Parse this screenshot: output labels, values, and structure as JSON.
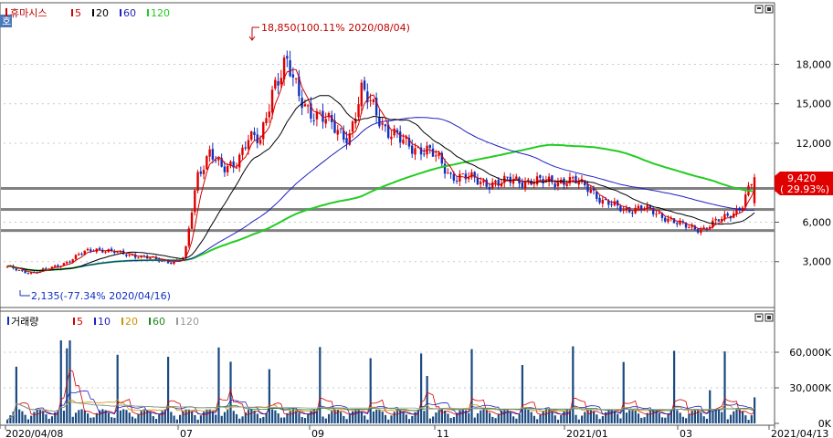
{
  "price_panel": {
    "title": "휴마시스",
    "legend": [
      {
        "label": "5",
        "color": "#d00000"
      },
      {
        "label": "20",
        "color": "#000000"
      },
      {
        "label": "60",
        "color": "#2020c0"
      },
      {
        "label": "120",
        "color": "#22cc22"
      }
    ],
    "high_annotation": "18,850(100.11% 2020/08/04)",
    "low_annotation": "2,135(-77.34% 2020/04/16)",
    "current_price": "9,420",
    "current_change": "( 29.93%)",
    "y_ticks": [
      "18,000",
      "15,000",
      "12,000",
      "6,000",
      "3,000"
    ]
  },
  "volume_panel": {
    "title": "거래량",
    "legend": [
      {
        "label": "5",
        "color": "#d00000"
      },
      {
        "label": "10",
        "color": "#2020c0"
      },
      {
        "label": "20",
        "color": "#d09000"
      },
      {
        "label": "60",
        "color": "#228822"
      },
      {
        "label": "120",
        "color": "#999999"
      }
    ],
    "y_ticks": [
      "60,000K",
      "30,000K",
      "0K"
    ]
  },
  "x_axis": {
    "labels": [
      "2020/04/08",
      "07",
      "09",
      "11",
      "2021/01",
      "03",
      "2021/04/13"
    ]
  },
  "side_tab": {
    "label": "호"
  },
  "colors": {
    "up": "#e00000",
    "down": "#1030c0",
    "ma5": "#d00000",
    "ma20": "#000000",
    "ma60": "#2020c0",
    "ma120": "#22cc22",
    "hline": "#808080"
  },
  "chart_data": {
    "type": "candlestick",
    "title": "휴마시스",
    "ylim": [
      0,
      21500
    ],
    "y_ticks": [
      3000,
      6000,
      12000,
      15000,
      18000
    ],
    "x_labels": [
      "2020/04/08",
      "07",
      "09",
      "11",
      "2021/01",
      "03",
      "2021/04/13"
    ],
    "approx_close_series": [
      2600,
      2300,
      2150,
      2400,
      2700,
      3100,
      3700,
      4000,
      3800,
      3600,
      3500,
      3300,
      3100,
      3000,
      3300,
      9500,
      11500,
      9800,
      10500,
      12500,
      12000,
      16500,
      18200,
      15500,
      14500,
      13800,
      13000,
      12600,
      15800,
      14800,
      12900,
      12200,
      11800,
      11500,
      10800,
      9600,
      9400,
      9200,
      9000,
      8900,
      9300,
      9100,
      9000,
      9200,
      9100,
      9000,
      8700,
      7500,
      7200,
      7000,
      7000,
      6800,
      6400,
      5800,
      5600,
      5500,
      6000,
      6600,
      7200,
      9420
    ],
    "moving_averages": [
      "5",
      "20",
      "60",
      "120"
    ],
    "horizontal_lines": [
      8600,
      7000,
      5400
    ],
    "high": {
      "value": 18850,
      "label": "18,850(100.11% 2020/08/04)"
    },
    "low": {
      "value": 2135,
      "label": "2,135(-77.34% 2020/04/16)"
    },
    "current": {
      "value": 9420,
      "change": "29.93%"
    },
    "volume_ticks": [
      "0K",
      "30,000K",
      "60,000K"
    ]
  }
}
